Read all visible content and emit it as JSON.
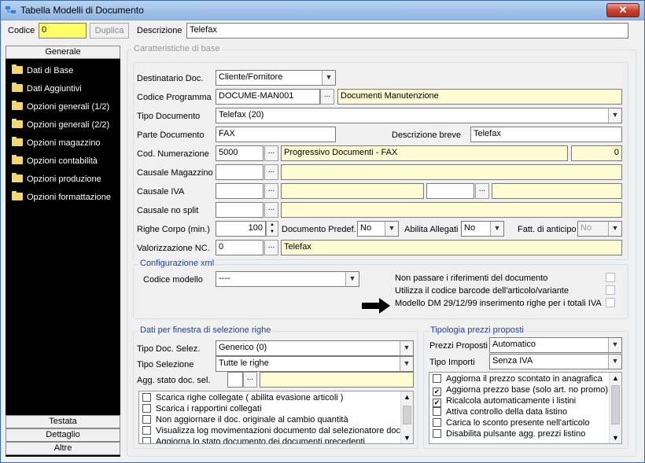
{
  "window": {
    "title": "Tabella Modelli di Documento",
    "close": "✕"
  },
  "top": {
    "codice_label": "Codice",
    "codice_value": "0",
    "duplica": "Duplica",
    "descrizione_label": "Descrizione",
    "descrizione_value": "Telefax"
  },
  "sidebar": {
    "header": "Generale",
    "items": [
      "Dati di Base",
      "Dati Aggiuntivi",
      "Opzioni generali (1/2)",
      "Opzioni generali (2/2)",
      "Opzioni magazzino",
      "Opzioni contabilità",
      "Opzioni produzione",
      "Opzioni formattazione"
    ],
    "tabs": [
      "Testata",
      "Dettaglio",
      "Altre"
    ]
  },
  "caratteristiche": {
    "title": "Caratteristiche di base",
    "destinatario_label": "Destinatario Doc.",
    "destinatario_value": "Cliente/Fornitore",
    "codice_programma_label": "Codice Programma",
    "codice_programma_value": "DOCUME-MAN001",
    "codice_programma_desc": "Documenti Manutenzione",
    "tipo_documento_label": "Tipo Documento",
    "tipo_documento_value": "Telefax (20)",
    "parte_documento_label": "Parte Documento",
    "parte_documento_value": "FAX",
    "descrizione_breve_label": "Descrizione breve",
    "descrizione_breve_value": "Telefax",
    "cod_numerazione_label": "Cod. Numerazione",
    "cod_numerazione_value": "5000",
    "cod_numerazione_desc": "Progressivo Documenti - FAX",
    "cod_numerazione_num": "0",
    "causale_magazzino_label": "Causale Magazzino",
    "causale_iva_label": "Causale IVA",
    "causale_no_split_label": "Causale no split",
    "righe_corpo_label": "Righe Corpo (min.)",
    "righe_corpo_value": "100",
    "documento_predef_label": "Documento Predef.",
    "documento_predef_value": "No",
    "abilita_allegati_label": "Abilita Allegati",
    "abilita_allegati_value": "No",
    "fatt_anticipo_label": "Fatt. di anticipo",
    "fatt_anticipo_value": "No",
    "valorizzazione_label": "Valorizzazione NC.",
    "valorizzazione_value": "0",
    "valorizzazione_desc": "Telefax"
  },
  "config_xml": {
    "title": "Configurazione xml",
    "codice_modello_label": "Codice modello",
    "codice_modello_value": "----",
    "opt1": "Non passare i riferimenti del documento",
    "opt2": "Utilizza il codice barcode dell'articolo/variante",
    "opt3": "Modello DM 29/12/99 inserimento righe per i totali IVA"
  },
  "selezione": {
    "title": "Dati per finestra di selezione righe",
    "tipo_doc_label": "Tipo Doc. Selez.",
    "tipo_doc_value": "Generico (0)",
    "tipo_sel_label": "Tipo Selezione",
    "tipo_sel_value": "Tutte le righe",
    "agg_stato_label": "Agg. stato doc. sel.",
    "checks": [
      "Scarica righe collegate ( abilita evasione articoli )",
      "Scarica i rapportini collegati",
      "Non aggiornare il doc. originale al cambio quantità",
      "Visualizza log movimentazioni documento dal selezionatore doc.",
      "Aggiorna lo stato documento dei documenti precedenti"
    ]
  },
  "prezzi": {
    "title": "Tipologia prezzi proposti",
    "prezzi_label": "Prezzi Proposti",
    "prezzi_value": "Automatico",
    "importi_label": "Tipo Importi",
    "importi_value": "Senza IVA",
    "checks": [
      {
        "label": "Aggiorna il prezzo scontato in anagrafica",
        "checked": false
      },
      {
        "label": "Aggiorna prezzo base (solo art. no promo)",
        "checked": true
      },
      {
        "label": "Ricalcola automaticamente i listini",
        "checked": true
      },
      {
        "label": "Attiva controllo della data listino",
        "checked": false
      },
      {
        "label": "Carica lo sconto presente nell'articolo",
        "checked": false
      },
      {
        "label": "Disabilita pulsante agg. prezzi listino",
        "checked": false
      }
    ]
  },
  "colors": {
    "title_bar": "#b9d3f0",
    "sidebar_bg": "#000000",
    "yellow_field": "#fffbd2",
    "highlight": "#ffff66",
    "group_title": "#1f3f9f",
    "close_button": "#c8452f"
  },
  "icons": {
    "app": "app-icon",
    "close": "close-icon",
    "folder": "folder-icon",
    "dropdown": "chevron-down-icon",
    "arrow": "right-arrow-icon",
    "checkmark": "check-icon"
  }
}
